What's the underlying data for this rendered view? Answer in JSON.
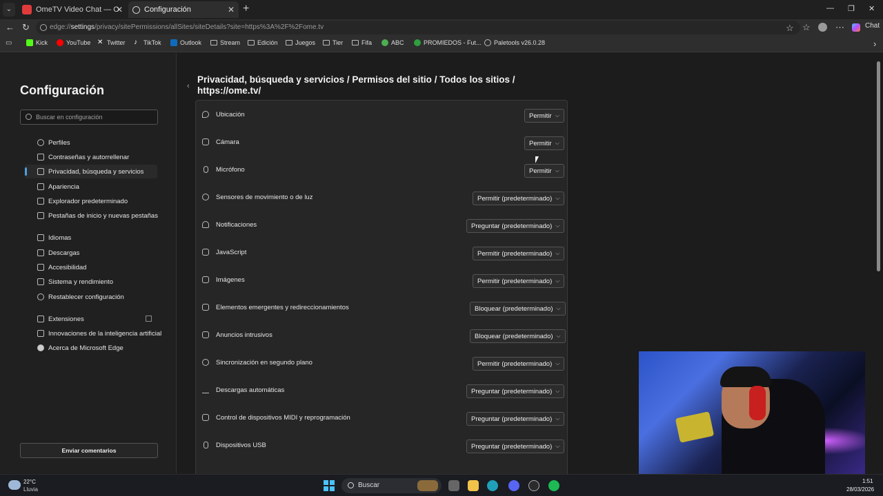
{
  "browser": {
    "tabs": [
      {
        "title": "OmeTV Video Chat — Omegle Random"
      },
      {
        "title": "Configuración"
      }
    ],
    "url_prefix": "edge://",
    "url_main": "settings",
    "url_rest": "/privacy/sitePermissions/allSites/siteDetails?site=https%3A%2F%2Fome.tv",
    "chat_label": "Chat"
  },
  "bookmarks": [
    {
      "label": "Kick",
      "icon": "kick-icon",
      "color": "#53fc18"
    },
    {
      "label": "YouTube",
      "icon": "youtube-icon",
      "color": "#ff0000"
    },
    {
      "label": "Twitter",
      "icon": "x-icon",
      "color": "#ffffff"
    },
    {
      "label": "TikTok",
      "icon": "tiktok-icon",
      "color": "#ffffff"
    },
    {
      "label": "Outlook",
      "icon": "outlook-icon",
      "color": "#0f6cbd"
    },
    {
      "label": "Stream",
      "icon": "folder-icon",
      "color": "#bbbbbb"
    },
    {
      "label": "Edición",
      "icon": "folder-icon",
      "color": "#bbbbbb"
    },
    {
      "label": "Juegos",
      "icon": "folder-icon",
      "color": "#bbbbbb"
    },
    {
      "label": "Tier",
      "icon": "folder-icon",
      "color": "#bbbbbb"
    },
    {
      "label": "Fifa",
      "icon": "folder-icon",
      "color": "#bbbbbb"
    },
    {
      "label": "ABC",
      "icon": "abc-icon",
      "color": "#4caf50"
    },
    {
      "label": "PROMIEDOS - Fut...",
      "icon": "promiedos-icon",
      "color": "#2e9e3e"
    },
    {
      "label": "Paletools v26.0.28",
      "icon": "globe-icon",
      "color": "#bbbbbb"
    }
  ],
  "sidebar": {
    "title": "Configuración",
    "search_placeholder": "Buscar en configuración",
    "items": [
      {
        "label": "Perfiles",
        "icon": "profile-icon"
      },
      {
        "label": "Contraseñas y autorrellenar",
        "icon": "key-icon"
      },
      {
        "label": "Privacidad, búsqueda y servicios",
        "icon": "lock-icon"
      },
      {
        "label": "Apariencia",
        "icon": "appearance-icon"
      },
      {
        "label": "Explorador predeterminado",
        "icon": "browser-icon"
      },
      {
        "label": "Pestañas de inicio y nuevas pestañas",
        "icon": "tabs-icon"
      },
      {
        "label": "Idiomas",
        "icon": "language-icon"
      },
      {
        "label": "Descargas",
        "icon": "download-icon"
      },
      {
        "label": "Accesibilidad",
        "icon": "accessibility-icon"
      },
      {
        "label": "Sistema y rendimiento",
        "icon": "system-icon"
      },
      {
        "label": "Restablecer configuración",
        "icon": "reset-icon"
      },
      {
        "label": "Extensiones",
        "icon": "extensions-icon"
      },
      {
        "label": "Innovaciones de la inteligencia artificial",
        "icon": "ai-icon"
      },
      {
        "label": "Acerca de Microsoft Edge",
        "icon": "edge-icon"
      }
    ],
    "feedback_label": "Enviar comentarios"
  },
  "main": {
    "breadcrumb": {
      "crumb1": "Privacidad, búsqueda y servicios",
      "crumb2": "Permisos del sitio",
      "crumb3": "Todos los sitios",
      "crumb4": "https://ome.tv/",
      "separator": "/"
    },
    "permissions": [
      {
        "label": "Ubicación",
        "value": "Permitir",
        "icon": "location-icon"
      },
      {
        "label": "Cámara",
        "value": "Permitir",
        "icon": "camera-icon"
      },
      {
        "label": "Micrófono",
        "value": "Permitir",
        "icon": "microphone-icon"
      },
      {
        "label": "Sensores de movimiento o de luz",
        "value": "Permitir (predeterminado)",
        "icon": "sensor-icon"
      },
      {
        "label": "Notificaciones",
        "value": "Preguntar (predeterminado)",
        "icon": "bell-icon"
      },
      {
        "label": "JavaScript",
        "value": "Permitir (predeterminado)",
        "icon": "javascript-icon"
      },
      {
        "label": "Imágenes",
        "value": "Permitir (predeterminado)",
        "icon": "image-icon"
      },
      {
        "label": "Elementos emergentes y redireccionamientos",
        "value": "Bloquear (predeterminado)",
        "icon": "popup-icon"
      },
      {
        "label": "Anuncios intrusivos",
        "value": "Bloquear (predeterminado)",
        "icon": "ads-icon"
      },
      {
        "label": "Sincronización en segundo plano",
        "value": "Permitir (predeterminado)",
        "icon": "sync-icon"
      },
      {
        "label": "Descargas automáticas",
        "value": "Preguntar (predeterminado)",
        "icon": "download-icon"
      },
      {
        "label": "Control de dispositivos MIDI y reprogramación",
        "value": "Preguntar (predeterminado)",
        "icon": "midi-icon"
      },
      {
        "label": "Dispositivos USB",
        "value": "Preguntar (predeterminado)",
        "icon": "usb-icon"
      }
    ]
  },
  "taskbar": {
    "temp": "22°C",
    "weather": "Lluvia",
    "search_label": "Buscar",
    "time": "1:51",
    "date": "28/03/2026"
  },
  "colors": {
    "accent": "#4ca0e0",
    "start": "#4cc2ff"
  }
}
